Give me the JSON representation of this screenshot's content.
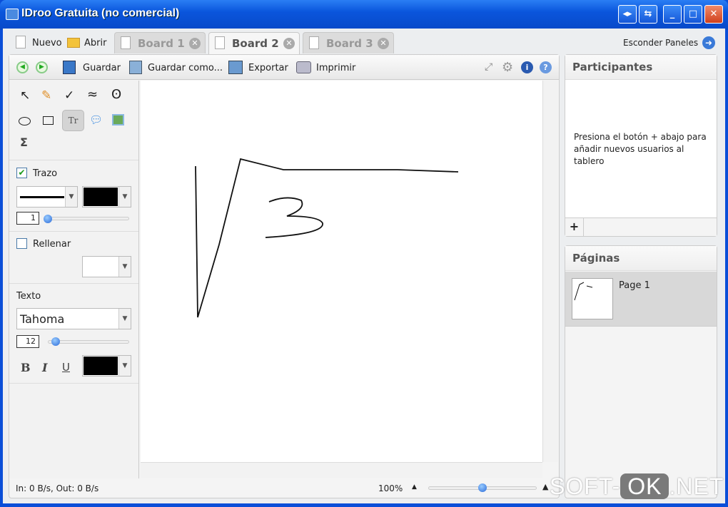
{
  "window": {
    "title": "IDroo Gratuita (no comercial)"
  },
  "tabs": {
    "new_label": "Nuevo",
    "open_label": "Abrir",
    "boards": [
      {
        "label": "Board 1",
        "active": false
      },
      {
        "label": "Board 2",
        "active": true
      },
      {
        "label": "Board 3",
        "active": false
      }
    ],
    "hide_panels_label": "Esconder Paneles"
  },
  "toolbar": {
    "save_label": "Guardar",
    "save_as_label": "Guardar como...",
    "export_label": "Exportar",
    "print_label": "Imprimir"
  },
  "tools": {
    "stroke_label": "Trazo",
    "stroke_checked": true,
    "stroke_width": "1",
    "stroke_color": "#000000",
    "fill_label": "Rellenar",
    "fill_checked": false,
    "fill_color": "#ffffff",
    "text_label": "Texto",
    "font": "Tahoma",
    "font_size": "12",
    "text_color": "#000000",
    "bold": "B",
    "italic": "I",
    "underline": "U",
    "sigma": "Σ",
    "text_tool": "Tr"
  },
  "participants": {
    "title": "Participantes",
    "hint": "Presiona el botón + abajo para añadir nuevos usuarios al tablero",
    "add": "+"
  },
  "pages": {
    "title": "Páginas",
    "items": [
      {
        "label": "Page 1"
      }
    ]
  },
  "status": {
    "traffic": "In: 0 B/s, Out: 0 B/s",
    "zoom": "100%",
    "zoom_level": 0.5
  },
  "watermark": {
    "text": "SOFT-OK.NET"
  }
}
